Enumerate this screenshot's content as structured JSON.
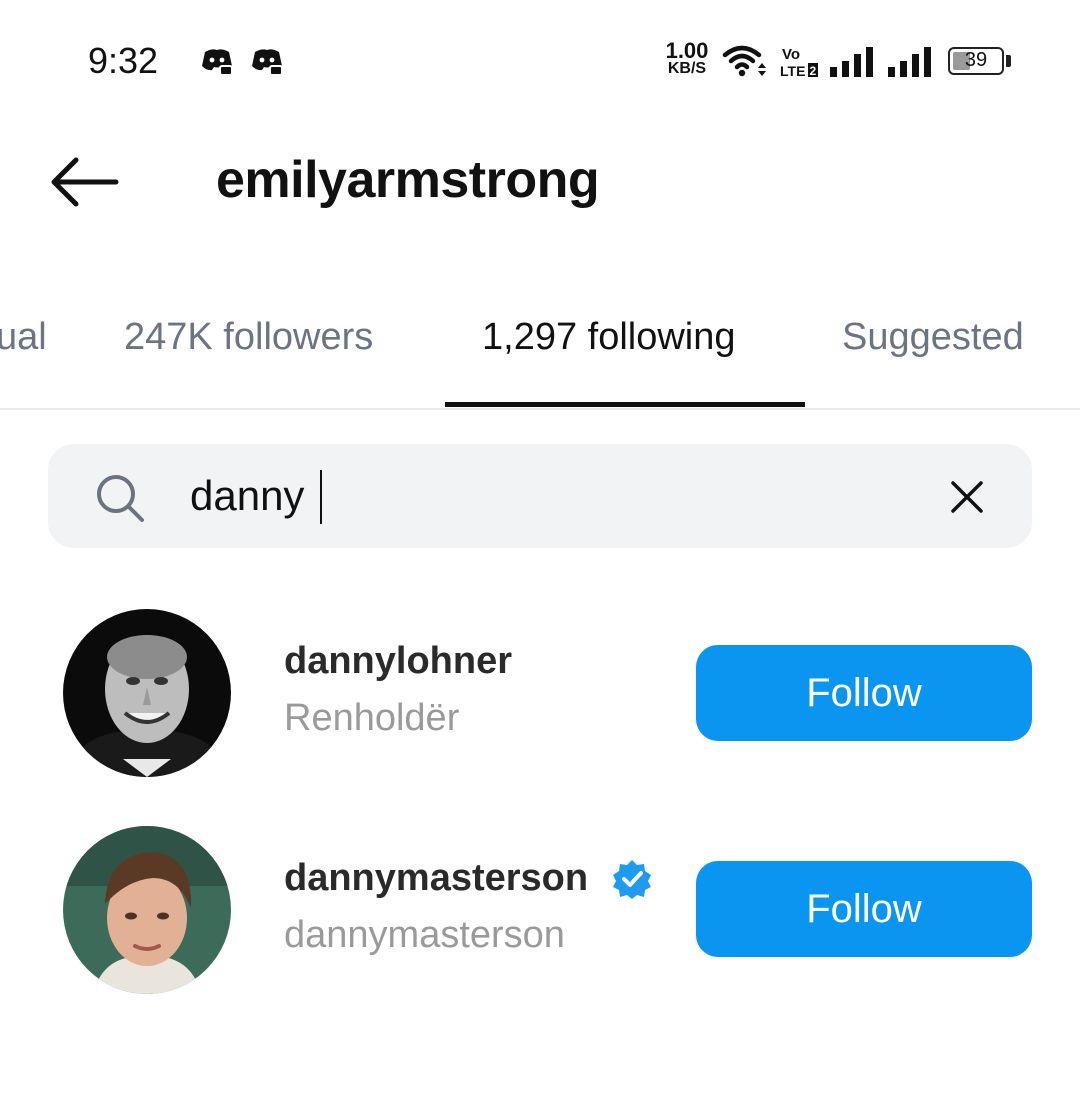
{
  "status_bar": {
    "time": "9:32",
    "net_speed_value": "1.00",
    "net_speed_unit": "KB/S",
    "battery_level": "39",
    "icons": [
      "discord-icon",
      "discord-icon",
      "wifi-icon",
      "volte-lte2-icon",
      "signal-icon",
      "signal-icon",
      "battery-icon"
    ]
  },
  "header": {
    "title": "emilyarmstrong",
    "back_icon": "arrow-left-icon"
  },
  "tabs": [
    {
      "label": "ual",
      "active": false
    },
    {
      "label": "247K followers",
      "active": false
    },
    {
      "label": "1,297 following",
      "active": true
    },
    {
      "label": "Suggested",
      "active": false
    }
  ],
  "search": {
    "value": "danny",
    "icon": "search-icon",
    "clear_icon": "close-icon"
  },
  "results": [
    {
      "username": "dannylohner",
      "subtitle": "Renholdër",
      "verified": false,
      "button": "Follow"
    },
    {
      "username": "dannymasterson",
      "subtitle": "dannymasterson",
      "verified": true,
      "button": "Follow"
    }
  ],
  "colors": {
    "accent": "#0a95f0",
    "text": "#111111",
    "secondary_text": "#9a9a9a",
    "tab_inactive": "#6b7480",
    "search_bg": "#f2f3f5",
    "verified": "#1d9bf0"
  }
}
